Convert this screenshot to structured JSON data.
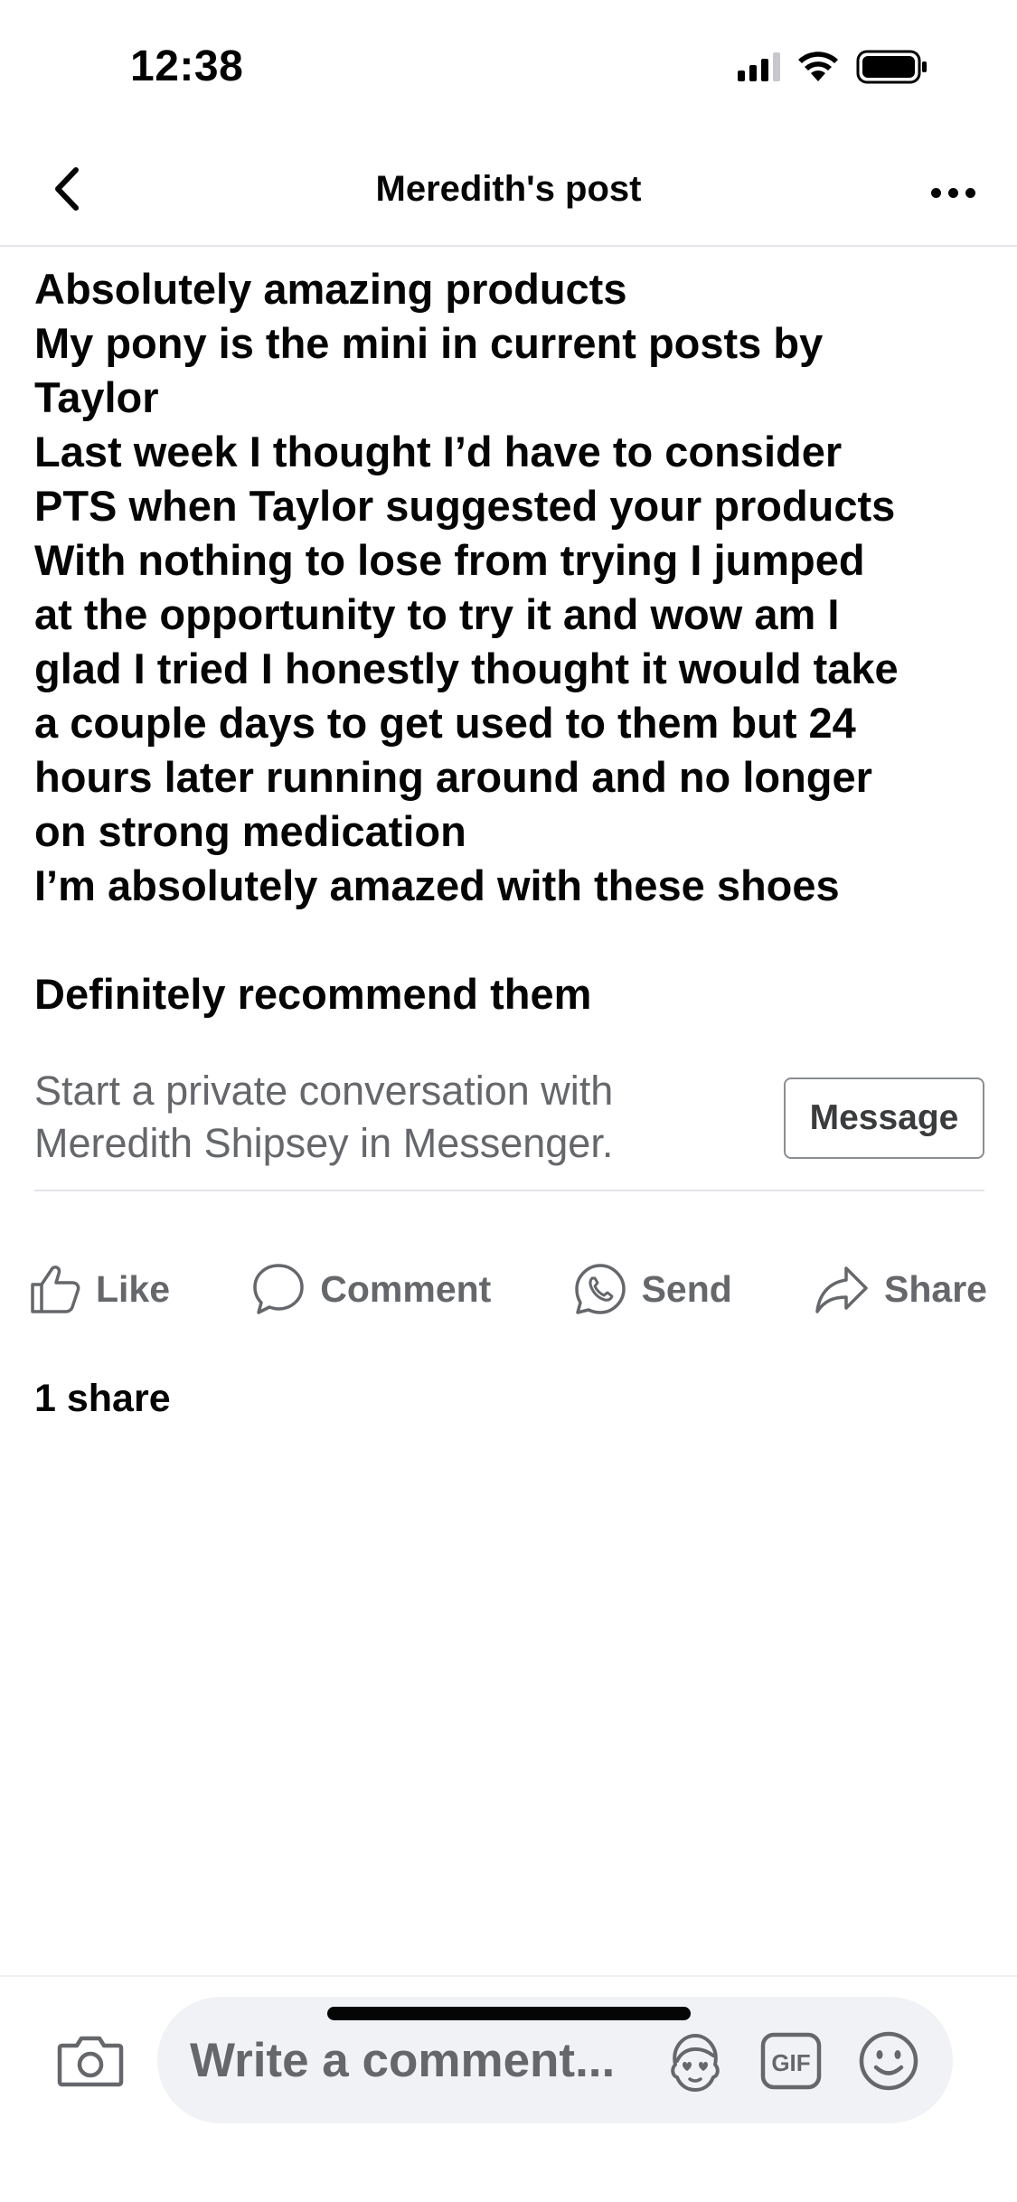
{
  "status_bar": {
    "time": "12:38",
    "icons": [
      "cellular-signal-icon",
      "wifi-icon",
      "battery-icon"
    ]
  },
  "header": {
    "title": "Meredith's post",
    "back_icon": "chevron-left-icon",
    "more_icon": "more-horizontal-icon"
  },
  "post": {
    "lines": [
      "Absolutely amazing products",
      "My pony is the mini in current posts by",
      "Taylor",
      "Last week I thought I’d have to consider",
      "PTS when Taylor suggested your products",
      "With nothing to lose from trying I jumped",
      "at the opportunity to try it and wow am I",
      "glad I tried I honestly thought it would take",
      "a couple days to get used to them but 24",
      "hours later running around and no longer",
      "on strong medication",
      "I’m absolutely amazed with these shoes",
      "",
      "Definitely recommend them"
    ]
  },
  "messenger": {
    "line1": "Start a private conversation with",
    "line2": "Meredith Shipsey in Messenger.",
    "button_label": "Message"
  },
  "actions": {
    "like": "Like",
    "comment": "Comment",
    "send": "Send",
    "share": "Share"
  },
  "stats": {
    "shares": "1 share"
  },
  "composer": {
    "placeholder": "Write a comment...",
    "gif_label": "GIF"
  },
  "colors": {
    "text_primary": "#050505",
    "text_secondary": "#65676b",
    "composer_bg": "#f0f2f5",
    "divider": "#e4e6eb"
  }
}
